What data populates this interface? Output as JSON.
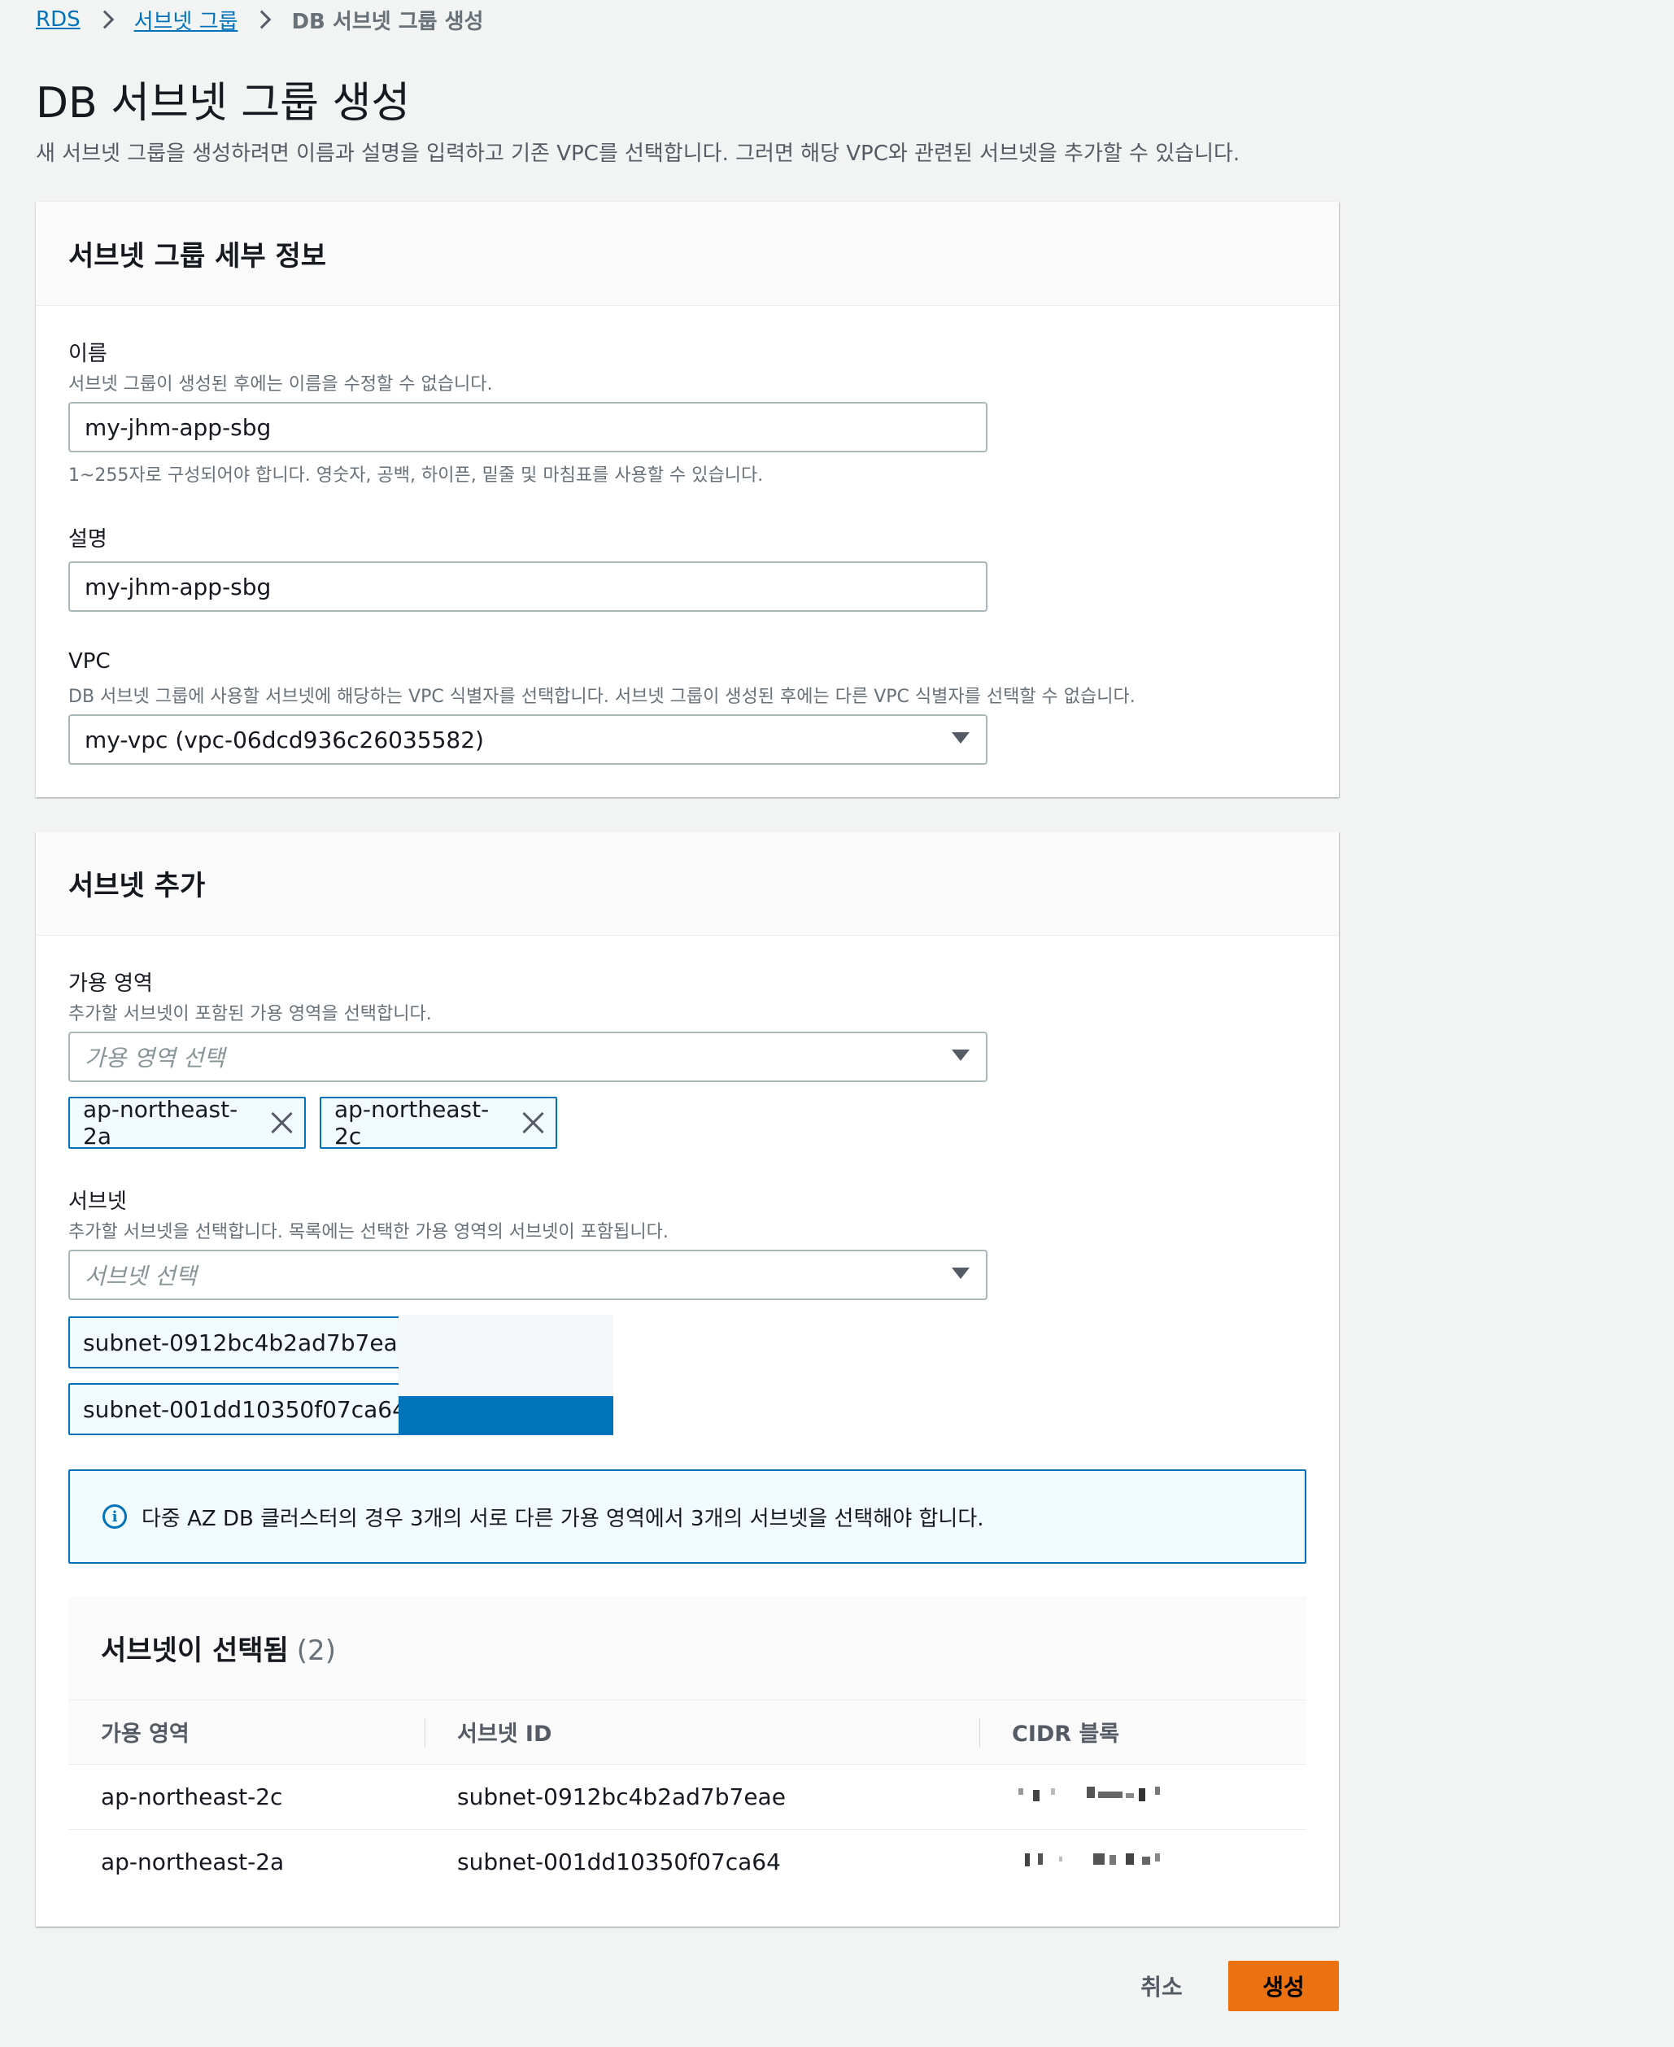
{
  "breadcrumb": {
    "root": "RDS",
    "parent": "서브넷 그룹",
    "current": "DB 서브넷 그룹 생성"
  },
  "page": {
    "title": "DB 서브넷 그룹 생성",
    "description": "새 서브넷 그룹을 생성하려면 이름과 설명을 입력하고 기존 VPC를 선택합니다. 그러면 해당 VPC와 관련된 서브넷을 추가할 수 있습니다."
  },
  "details": {
    "heading": "서브넷 그룹 세부 정보",
    "name_label": "이름",
    "name_desc": "서브넷 그룹이 생성된 후에는 이름을 수정할 수 없습니다.",
    "name_value": "my-jhm-app-sbg",
    "name_constraint": "1~255자로 구성되어야 합니다. 영숫자, 공백, 하이픈, 밑줄 및 마침표를 사용할 수 있습니다.",
    "desc_label": "설명",
    "desc_value": "my-jhm-app-sbg",
    "vpc_label": "VPC",
    "vpc_desc": "DB 서브넷 그룹에 사용할 서브넷에 해당하는 VPC 식별자를 선택합니다. 서브넷 그룹이 생성된 후에는 다른 VPC 식별자를 선택할 수 없습니다.",
    "vpc_value": "my-vpc (vpc-06dcd936c26035582)"
  },
  "add_subnets": {
    "heading": "서브넷 추가",
    "az_label": "가용 영역",
    "az_desc": "추가할 서브넷이 포함된 가용 영역을 선택합니다.",
    "az_placeholder": "가용 영역 선택",
    "az_tokens": [
      "ap-northeast-2a",
      "ap-northeast-2c"
    ],
    "subnet_label": "서브넷",
    "subnet_desc": "추가할 서브넷을 선택합니다. 목록에는 선택한 가용 영역의 서브넷이 포함됩니다.",
    "subnet_placeholder": "서브넷 선택",
    "subnet_tokens": [
      "subnet-0912bc4b2ad7b7eae (",
      "subnet-001dd10350f07ca64 ("
    ],
    "alert": "다중 AZ DB 클러스터의 경우 3개의 서로 다른 가용 영역에서 3개의 서브넷을 선택해야 합니다."
  },
  "selected": {
    "heading": "서브넷이 선택됨",
    "count": "(2)",
    "columns": [
      "가용 영역",
      "서브넷 ID",
      "CIDR 블록"
    ],
    "rows": [
      {
        "az": "ap-northeast-2c",
        "subnet_id": "subnet-0912bc4b2ad7b7eae",
        "cidr": ""
      },
      {
        "az": "ap-northeast-2a",
        "subnet_id": "subnet-001dd10350f07ca64",
        "cidr": ""
      }
    ]
  },
  "actions": {
    "cancel": "취소",
    "create": "생성"
  },
  "colors": {
    "primary": "#ec7211",
    "link": "#0073bb",
    "token_bg": "#f1faff"
  }
}
